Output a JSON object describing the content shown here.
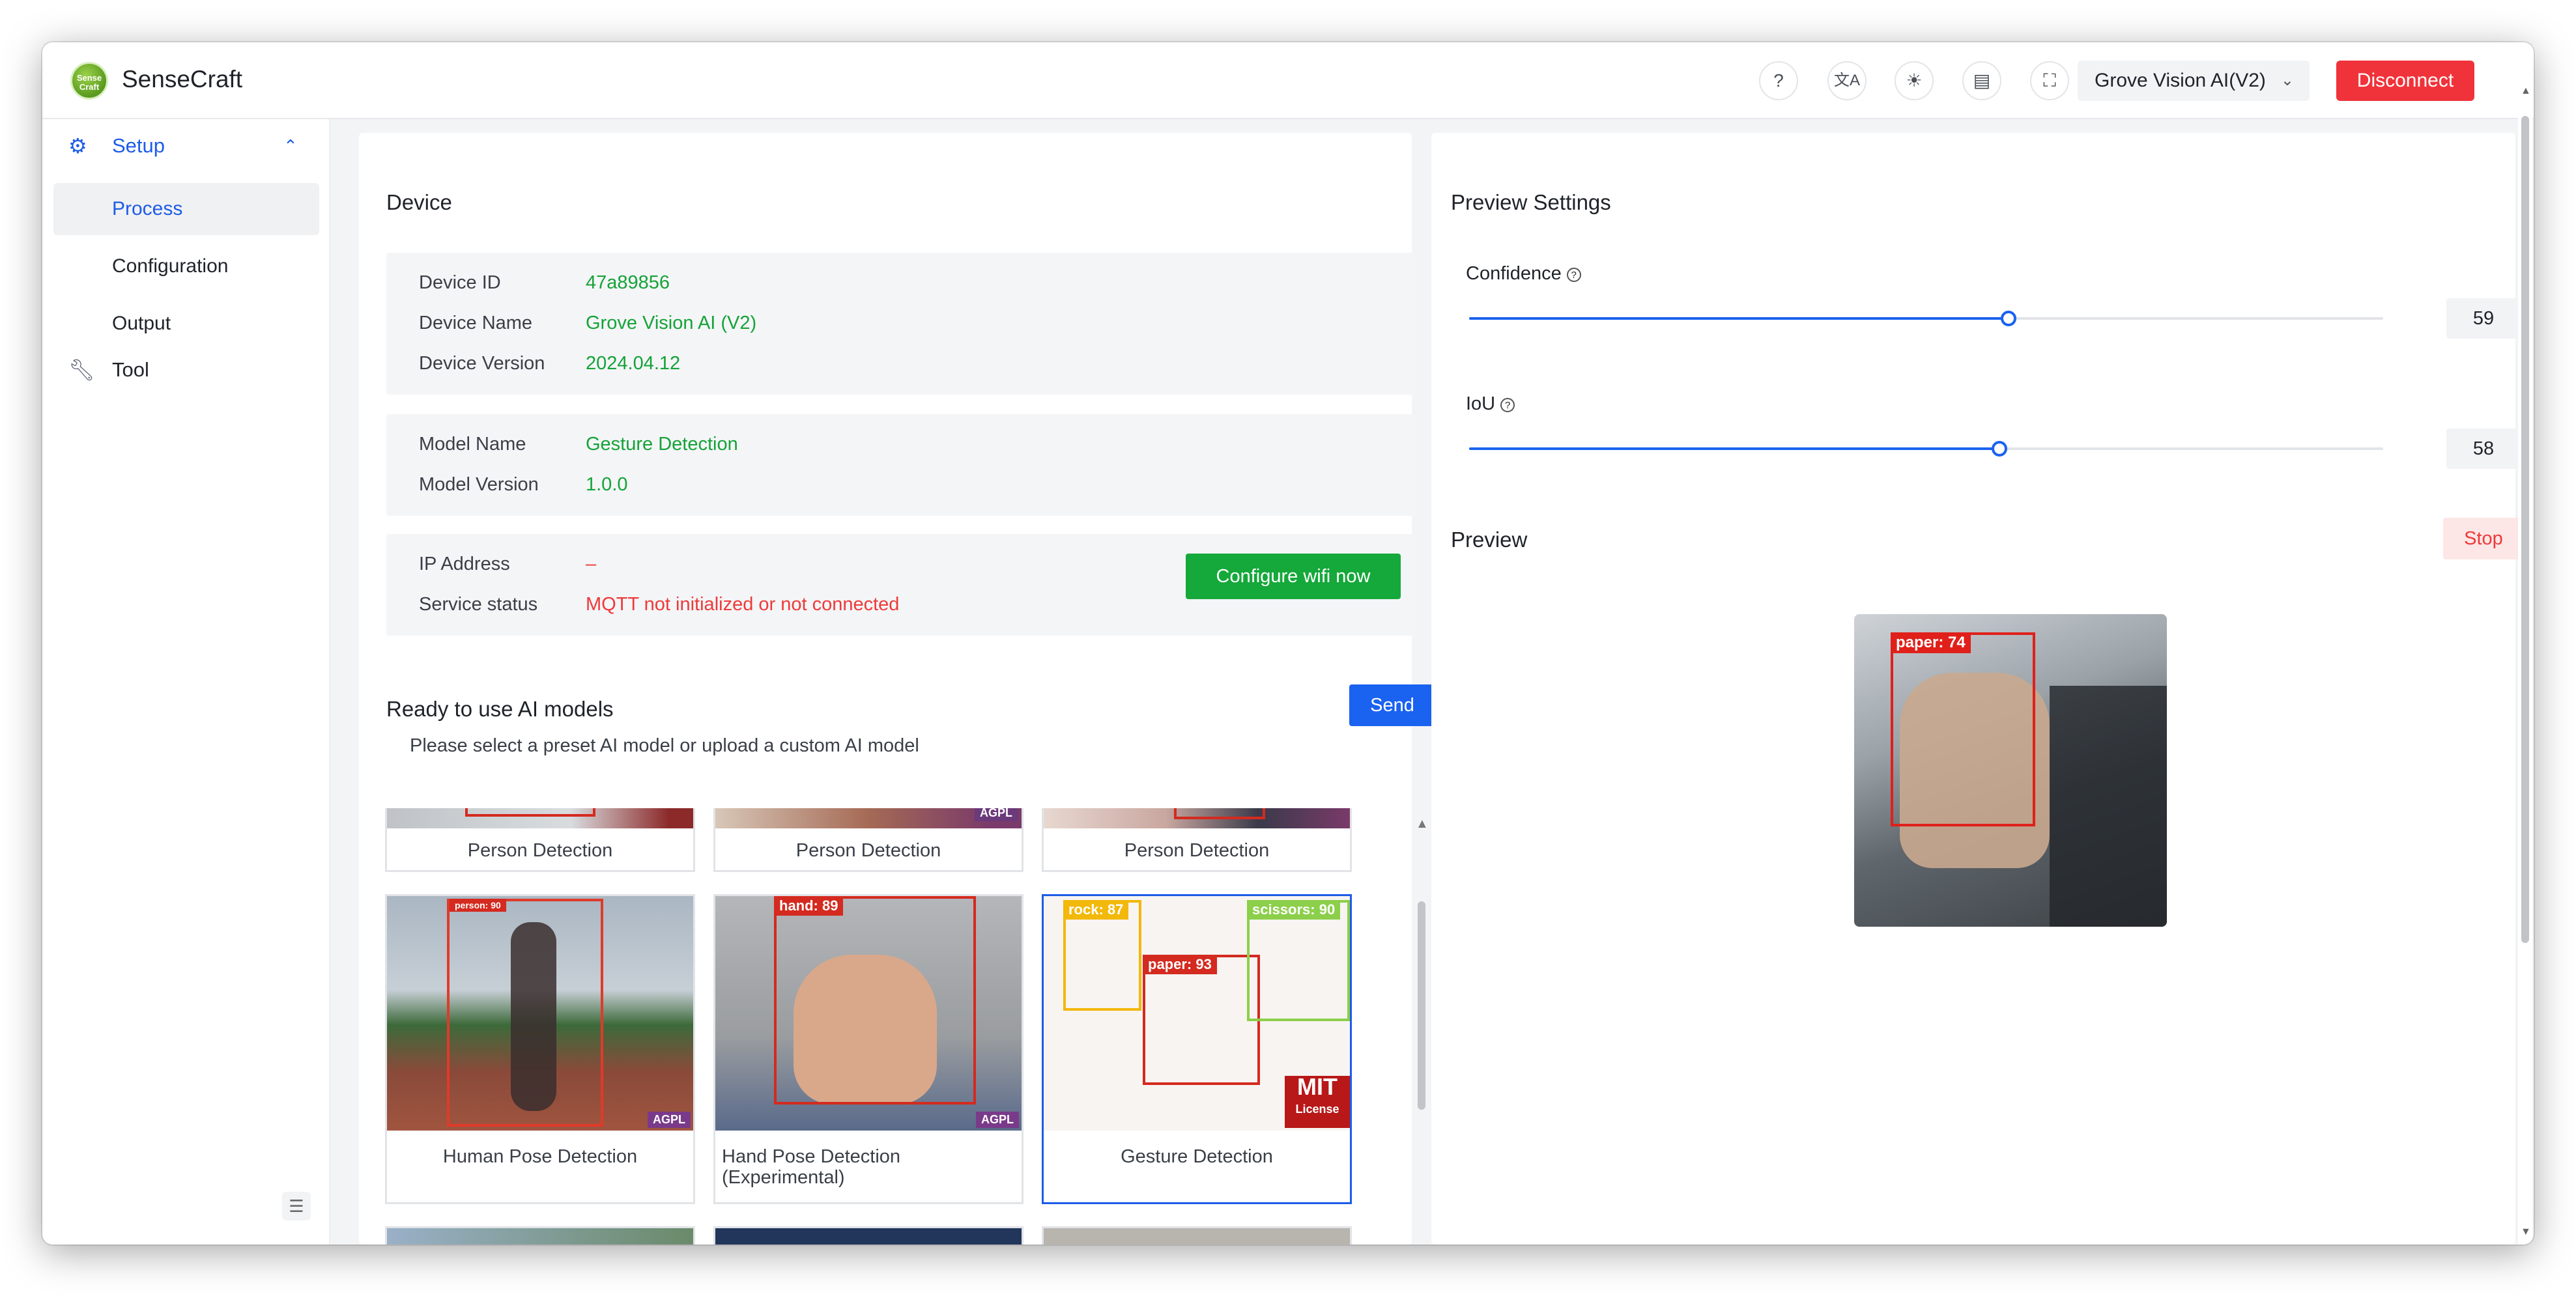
{
  "header": {
    "logo_text": "Sense Craft",
    "brand": "SenseCraft",
    "icons": [
      "help-icon",
      "translate-icon",
      "theme-icon",
      "docs-icon",
      "fullscreen-icon"
    ],
    "device_select": "Grove Vision AI(V2)",
    "disconnect_label": "Disconnect"
  },
  "sidebar": {
    "setup_label": "Setup",
    "items": [
      {
        "label": "Process",
        "active": true
      },
      {
        "label": "Configuration",
        "active": false
      },
      {
        "label": "Output",
        "active": false
      }
    ],
    "tool_label": "Tool"
  },
  "device": {
    "title": "Device",
    "device_id_label": "Device ID",
    "device_id": "47a89856",
    "device_name_label": "Device Name",
    "device_name": "Grove Vision AI (V2)",
    "device_version_label": "Device Version",
    "device_version": "2024.04.12",
    "model_name_label": "Model Name",
    "model_name": "Gesture Detection",
    "model_version_label": "Model Version",
    "model_version": "1.0.0",
    "ip_label": "IP Address",
    "ip_value": "–",
    "service_label": "Service status",
    "service_value": "MQTT not initialized or not connected",
    "wifi_button": "Configure wifi now"
  },
  "models": {
    "title": "Ready to use AI models",
    "send_label": "Send",
    "subtitle": "Please select a preset AI model or upload a custom AI model",
    "top_row": [
      "Person Detection",
      "Person Detection",
      "Person Detection"
    ],
    "cards": [
      {
        "name": "Human Pose Detection",
        "box_label": "person: 90"
      },
      {
        "name": "Hand Pose Detection (Experimental)",
        "box_label": "hand: 89"
      },
      {
        "name": "Gesture Detection",
        "selected": true,
        "labels": [
          "rock: 87",
          "paper: 93",
          "scissors: 90"
        ]
      }
    ],
    "badges": {
      "agpl": "AGPL",
      "license": "License",
      "mit": "MIT"
    }
  },
  "preview_settings": {
    "title": "Preview Settings",
    "confidence_label": "Confidence",
    "confidence_value": "59",
    "iou_label": "IoU",
    "iou_value": "58",
    "preview_title": "Preview",
    "stop_label": "Stop",
    "detection_label": "paper: 74"
  },
  "colors": {
    "primary": "#1a62f0",
    "success": "#15a83a",
    "danger": "#f0333a"
  }
}
